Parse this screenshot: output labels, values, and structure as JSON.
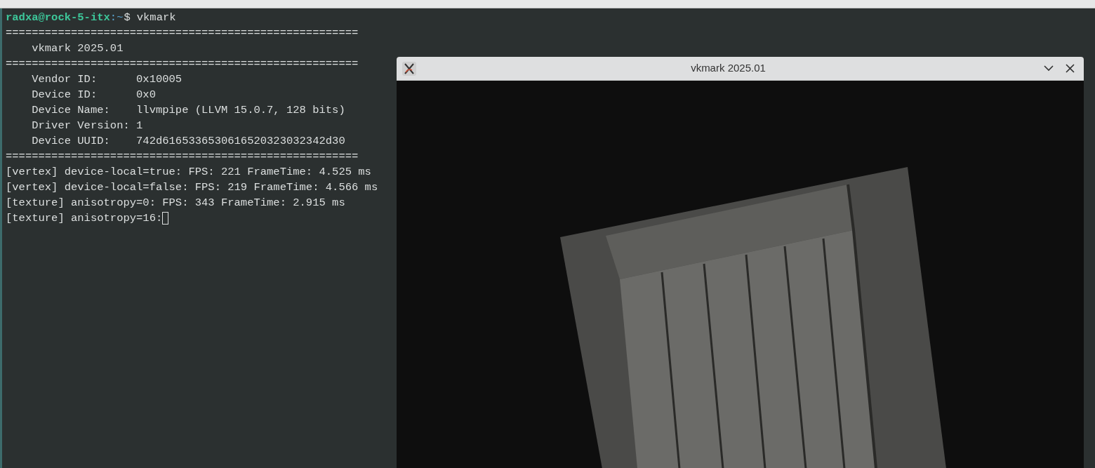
{
  "terminal": {
    "prompt": {
      "user_host": "radxa@rock-5-itx",
      "path": ":~",
      "sign": "$",
      "command": "vkmark"
    },
    "lines": [
      {
        "text": "======================================================",
        "cursor": false
      },
      {
        "text": "    vkmark 2025.01",
        "cursor": false
      },
      {
        "text": "======================================================",
        "cursor": false
      },
      {
        "text": "    Vendor ID:      0x10005",
        "cursor": false
      },
      {
        "text": "    Device ID:      0x0",
        "cursor": false
      },
      {
        "text": "    Device Name:    llvmpipe (LLVM 15.0.7, 128 bits)",
        "cursor": false
      },
      {
        "text": "    Driver Version: 1",
        "cursor": false
      },
      {
        "text": "    Device UUID:    742d6165336530616520323032342d30",
        "cursor": false
      },
      {
        "text": "======================================================",
        "cursor": false
      },
      {
        "text": "[vertex] device-local=true: FPS: 221 FrameTime: 4.525 ms",
        "cursor": false
      },
      {
        "text": "[vertex] device-local=false: FPS: 219 FrameTime: 4.566 ms",
        "cursor": false
      },
      {
        "text": "[texture] anisotropy=0: FPS: 343 FrameTime: 2.915 ms",
        "cursor": false
      },
      {
        "text": "[texture] anisotropy=16:",
        "cursor": true
      }
    ]
  },
  "window": {
    "title": "vkmark 2025.01"
  }
}
